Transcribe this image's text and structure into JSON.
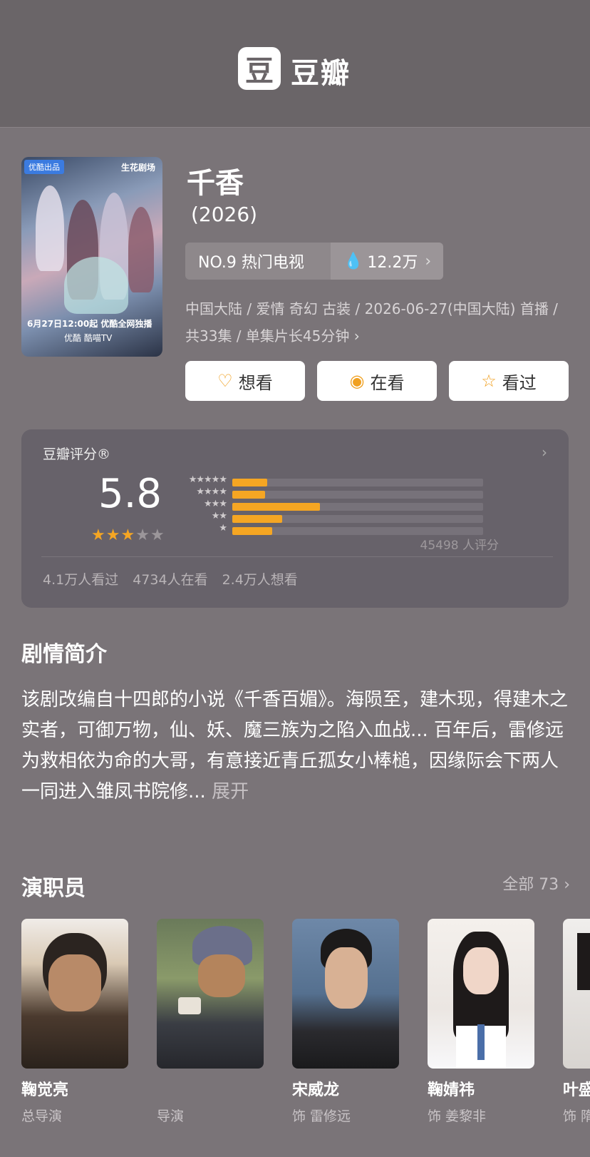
{
  "header": {
    "logo_char": "豆",
    "app_name": "豆瓣"
  },
  "poster": {
    "badge": "优酷出品",
    "studio": "生花剧场",
    "caption": "6月27日12:00起 优酷全网独播",
    "brands": "优酷  酷喵TV"
  },
  "movie": {
    "title": "千香",
    "year": "(2026)",
    "rank": "NO.9 热门电视",
    "heat": "12.2万",
    "meta": "中国大陆 / 爱情 奇幻 古装 / 2026-06-27(中国大陆) 首播 / 共33集 / 单集片长45分钟"
  },
  "actions": [
    {
      "label": "想看",
      "icon": "heart-plus-icon"
    },
    {
      "label": "在看",
      "icon": "target-icon"
    },
    {
      "label": "看过",
      "icon": "star-outline-icon"
    }
  ],
  "rating": {
    "label": "豆瓣评分®",
    "score": "5.8",
    "stars_filled": 3,
    "stars_total": 5,
    "distribution": [
      {
        "stars": 5,
        "fraction": 0.14
      },
      {
        "stars": 4,
        "fraction": 0.13
      },
      {
        "stars": 3,
        "fraction": 0.35
      },
      {
        "stars": 2,
        "fraction": 0.2
      },
      {
        "stars": 1,
        "fraction": 0.16
      }
    ],
    "count_text": "45498 人评分",
    "stats": [
      "4.1万人看过",
      "4734人在看",
      "2.4万人想看"
    ]
  },
  "synopsis": {
    "heading": "剧情简介",
    "text": "该剧改编自十四郎的小说《千香百媚》。海陨至，建木现，得建木之实者，可御万物，仙、妖、魔三族为之陷入血战... 百年后，雷修远为救相依为命的大哥，有意接近青丘孤女小棒槌，因缘际会下两人一同进入雏凤书院修...",
    "more": "展开"
  },
  "cast": {
    "heading": "演职员",
    "all_label": "全部 73",
    "members": [
      {
        "name": "鞠觉亮",
        "role": "总导演"
      },
      {
        "name": "",
        "role": "导演"
      },
      {
        "name": "宋威龙",
        "role": "饰 雷修远"
      },
      {
        "name": "鞠婧祎",
        "role": "饰 姜黎非"
      },
      {
        "name": "叶盛",
        "role": "饰 隋"
      }
    ]
  },
  "colors": {
    "accent": "#f5a623",
    "background": "#7a7478",
    "topbar": "#6a6568"
  }
}
